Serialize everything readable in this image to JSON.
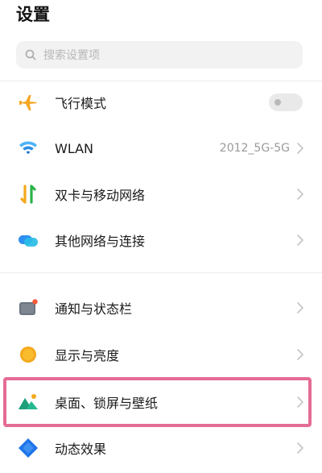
{
  "header": {
    "title": "设置"
  },
  "search": {
    "placeholder": "搜索设置项",
    "icon": "search-icon"
  },
  "rows": [
    {
      "label": "飞行模式",
      "icon": "airplane-icon",
      "control": "toggle",
      "toggle_on": false,
      "color": "#f5a623"
    },
    {
      "label": "WLAN",
      "icon": "wifi-icon",
      "value": "2012_5G-5G",
      "color": "#1e88e5"
    },
    {
      "label": "双卡与移动网络",
      "icon": "mobile-network-icon",
      "color": "#2ab34a"
    },
    {
      "label": "其他网络与连接",
      "icon": "other-connection-icon",
      "color": "#26a6e8"
    },
    {
      "label": "通知与状态栏",
      "icon": "notification-icon",
      "color": "#6b7480"
    },
    {
      "label": "显示与亮度",
      "icon": "brightness-icon",
      "color": "#f6a81f"
    },
    {
      "label": "桌面、锁屏与壁纸",
      "icon": "wallpaper-icon",
      "color": "#25b98f",
      "highlighted": true
    },
    {
      "label": "动态效果",
      "icon": "dynamic-effect-icon",
      "color": "#1e74e8"
    }
  ],
  "highlight": {
    "color": "#e46c96"
  }
}
